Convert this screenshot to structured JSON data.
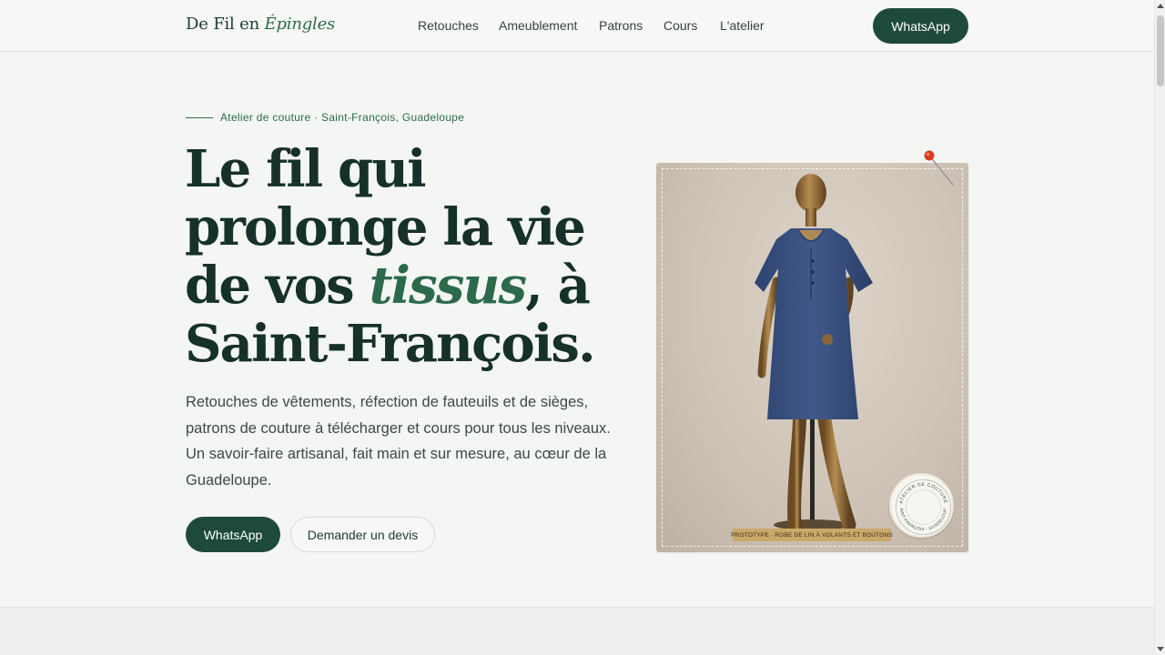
{
  "brand": {
    "logo_part1": "De Fil en ",
    "logo_part2": "Épingles"
  },
  "nav": [
    {
      "label": "Retouches"
    },
    {
      "label": "Ameublement"
    },
    {
      "label": "Patrons"
    },
    {
      "label": "Cours"
    },
    {
      "label": "L'atelier"
    }
  ],
  "header_cta": "WhatsApp",
  "hero": {
    "eyebrow": "Atelier de couture · Saint-François, Guadeloupe",
    "title_part1": "Le fil qui prolonge la vie de vos ",
    "title_emph": "tissus",
    "title_part2": ", à Saint-François.",
    "lead": "Retouches de vêtements, réfection de fauteuils et de sièges, patrons de couture à télécharger et cours pour tous les niveaux. Un savoir-faire artisanal, fait main et sur mesure, au cœur de la Guadeloupe.",
    "primary_cta": "WhatsApp",
    "secondary_cta": "Demander un devis"
  },
  "photo": {
    "caption": "PROTOTYPE · ROBE DE LIN À VOLANTS ET BOUTONS",
    "stamp_top": "ATELIER DE COUTURE",
    "stamp_bottom": "SAINT-FRANÇOIS · GUADELOUPE"
  },
  "colors": {
    "brand_green": "#1e4a3d",
    "accent_green": "#2c6a4c",
    "background": "#f4f6f3"
  },
  "icons": {
    "pin": "pushpin-icon"
  }
}
